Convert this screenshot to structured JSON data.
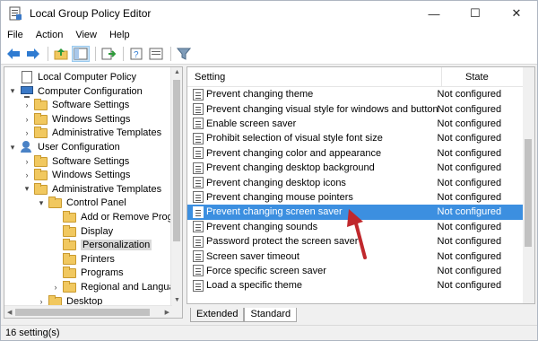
{
  "window": {
    "title": "Local Group Policy Editor",
    "minimize": "—",
    "maximize": "☐",
    "close": "✕"
  },
  "menu": [
    "File",
    "Action",
    "View",
    "Help"
  ],
  "toolbar": {
    "icons": [
      "back-icon",
      "forward-icon",
      "up-folder-icon",
      "show-hide-tree-icon",
      "export-list-icon",
      "help-icon",
      "properties-icon",
      "filter-icon"
    ]
  },
  "tree": {
    "items": [
      {
        "label": "Local Computer Policy",
        "expander": "",
        "icon": "policy-doc-icon"
      },
      {
        "label": "Computer Configuration",
        "expander": "▾",
        "icon": "computer-icon"
      },
      {
        "label": "Software Settings",
        "expander": "›",
        "icon": "folder-icon"
      },
      {
        "label": "Windows Settings",
        "expander": "›",
        "icon": "folder-icon"
      },
      {
        "label": "Administrative Templates",
        "expander": "›",
        "icon": "folder-icon"
      },
      {
        "label": "User Configuration",
        "expander": "▾",
        "icon": "user-icon"
      },
      {
        "label": "Software Settings",
        "expander": "›",
        "icon": "folder-icon"
      },
      {
        "label": "Windows Settings",
        "expander": "›",
        "icon": "folder-icon"
      },
      {
        "label": "Administrative Templates",
        "expander": "▾",
        "icon": "folder-icon"
      },
      {
        "label": "Control Panel",
        "expander": "▾",
        "icon": "folder-icon"
      },
      {
        "label": "Add or Remove Progr",
        "expander": "",
        "icon": "folder-icon"
      },
      {
        "label": "Display",
        "expander": "",
        "icon": "folder-icon"
      },
      {
        "label": "Personalization",
        "expander": "",
        "icon": "folder-icon"
      },
      {
        "label": "Printers",
        "expander": "",
        "icon": "folder-icon"
      },
      {
        "label": "Programs",
        "expander": "",
        "icon": "folder-icon"
      },
      {
        "label": "Regional and Langua",
        "expander": "›",
        "icon": "folder-icon"
      },
      {
        "label": "Desktop",
        "expander": "›",
        "icon": "folder-icon"
      }
    ],
    "selected": "Personalization"
  },
  "settings": {
    "header_setting": "Setting",
    "header_state": "State",
    "rows": [
      {
        "name": "Prevent changing theme",
        "state": "Not configured"
      },
      {
        "name": "Prevent changing visual style for windows and buttons",
        "state": "Not configured"
      },
      {
        "name": "Enable screen saver",
        "state": "Not configured"
      },
      {
        "name": "Prohibit selection of visual style font size",
        "state": "Not configured"
      },
      {
        "name": "Prevent changing color and appearance",
        "state": "Not configured"
      },
      {
        "name": "Prevent changing desktop background",
        "state": "Not configured"
      },
      {
        "name": "Prevent changing desktop icons",
        "state": "Not configured"
      },
      {
        "name": "Prevent changing mouse pointers",
        "state": "Not configured"
      },
      {
        "name": "Prevent changing screen saver",
        "state": "Not configured"
      },
      {
        "name": "Prevent changing sounds",
        "state": "Not configured"
      },
      {
        "name": "Password protect the screen saver",
        "state": "Not configured"
      },
      {
        "name": "Screen saver timeout",
        "state": "Not configured"
      },
      {
        "name": "Force specific screen saver",
        "state": "Not configured"
      },
      {
        "name": "Load a specific theme",
        "state": "Not configured"
      }
    ],
    "selected": "Prevent changing screen saver"
  },
  "tabs": [
    "Extended",
    "Standard"
  ],
  "active_tab": "Standard",
  "status": "16 setting(s)",
  "colors": {
    "selection": "#3c8fe0",
    "annotation_arrow": "#c0282d"
  }
}
